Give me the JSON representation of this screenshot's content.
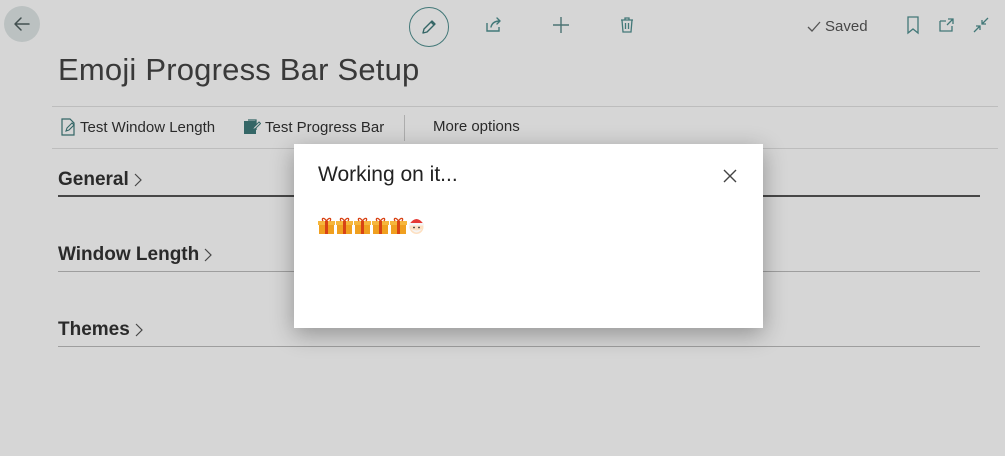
{
  "toolbar": {
    "saved_label": "Saved",
    "icons": [
      "back-arrow-icon",
      "pencil-icon",
      "share-icon",
      "plus-icon",
      "trash-icon",
      "checkmark-icon",
      "bookmark-icon",
      "open-in-new-icon",
      "collapse-icon"
    ]
  },
  "page": {
    "title": "Emoji Progress Bar Setup"
  },
  "actions": {
    "test_window_length": "Test Window Length",
    "test_progress_bar": "Test Progress Bar",
    "more_options": "More options"
  },
  "sections": {
    "general": "General",
    "window_length": "Window Length",
    "themes": "Themes"
  },
  "dialog": {
    "title": "Working on it...",
    "progress_icons": [
      "gift-emoji",
      "gift-emoji",
      "gift-emoji",
      "gift-emoji",
      "gift-emoji",
      "santa-emoji"
    ]
  },
  "colors": {
    "accent": "#4f8f8f",
    "gift_body": "#f0a020",
    "gift_ribbon": "#d84315",
    "santa_hat": "#e53935"
  }
}
